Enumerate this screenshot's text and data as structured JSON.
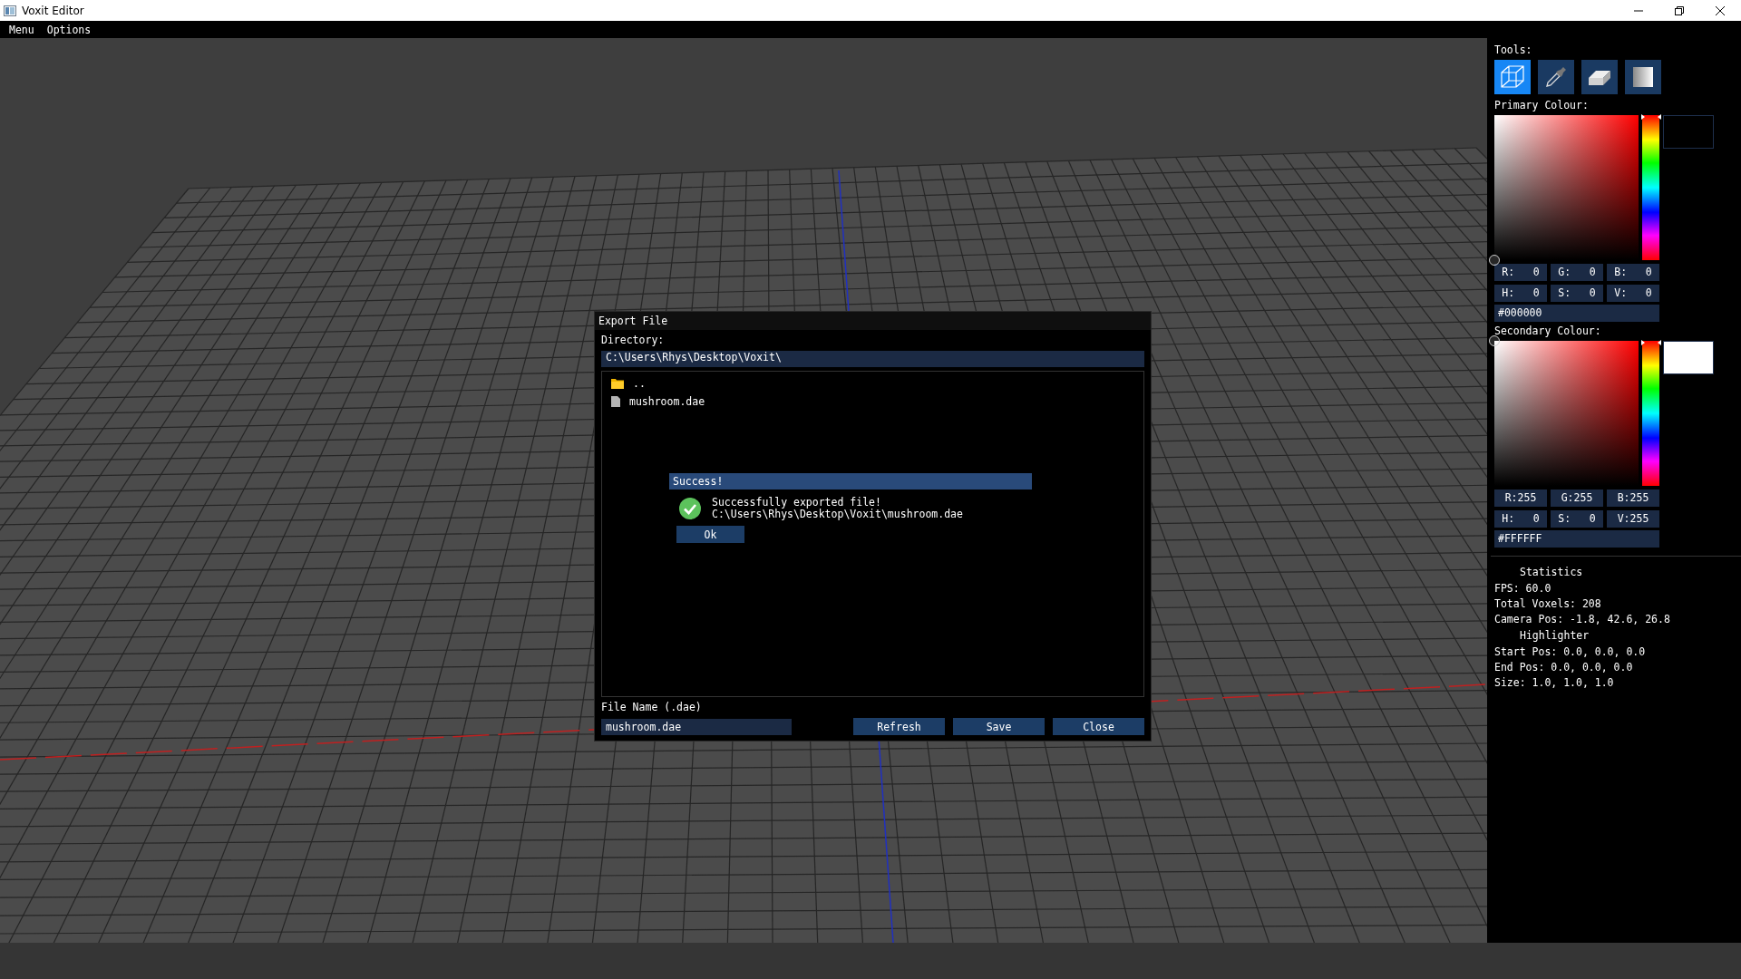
{
  "window": {
    "title": "Voxit Editor"
  },
  "menu_bar": [
    "Menu",
    "Options"
  ],
  "tools": {
    "label": "Tools:",
    "items": [
      {
        "kind": "cube",
        "selected": true
      },
      {
        "kind": "dropper",
        "selected": false
      },
      {
        "kind": "eraser",
        "selected": false
      },
      {
        "kind": "gradient",
        "selected": false
      }
    ]
  },
  "primary_colour": {
    "label": "Primary Colour:",
    "hue_slider": {
      "level": 0
    },
    "value_cursor": {
      "level": 0
    },
    "fields": [
      "R:   0",
      "G:   0",
      "B:   0",
      "H:   0",
      "S:   0",
      "V:   0"
    ],
    "hex": "#000000"
  },
  "secondary_colour": {
    "label": "Secondary Colour:",
    "hue_slider": {
      "level": 0
    },
    "value_cursor": {
      "level": 1
    },
    "fields": [
      "R:255",
      "G:255",
      "B:255",
      "H:   0",
      "S:   0",
      "V:255"
    ],
    "hex": "#FFFFFF"
  },
  "statistics": {
    "title": "Statistics",
    "lines": [
      "FPS: 60.0",
      "Total Voxels: 208",
      "Camera Pos: -1.8, 42.6, 26.8"
    ]
  },
  "highlighter": {
    "title": "Highlighter",
    "lines": [
      "Start Pos: 0.0, 0.0, 0.0",
      "End Pos: 0.0, 0.0, 0.0",
      "Size: 1.0, 1.0, 1.0"
    ]
  },
  "export_dialog": {
    "title": "Export File",
    "directory_label": "Directory:",
    "directory": "C:\\Users\\Rhys\\Desktop\\Voxit\\",
    "entries": [
      {
        "kind": "folder",
        "name": ".."
      },
      {
        "kind": "file",
        "name": "mushroom.dae"
      }
    ],
    "file_name_label": "File Name (.dae)",
    "file_name": "mushroom.dae",
    "buttons": [
      "Refresh",
      "Save",
      "Close"
    ]
  },
  "success_popup": {
    "title": "Success!",
    "message": "Successfully exported file!",
    "path": "C:\\Users\\Rhys\\Desktop\\Voxit\\mushroom.dae",
    "button": "Ok"
  }
}
